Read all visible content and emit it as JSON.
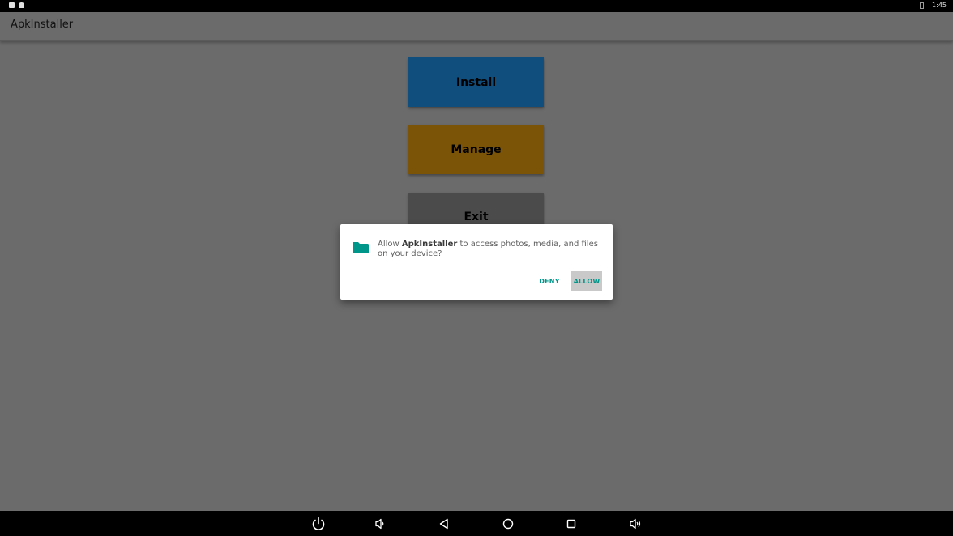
{
  "status_bar": {
    "time": "1:45",
    "left_icons": [
      "notification-icon",
      "android-icon"
    ],
    "right_icons": [
      "battery-icon"
    ]
  },
  "app_bar": {
    "title": "ApkInstaller"
  },
  "main": {
    "install_label": "Install",
    "manage_label": "Manage",
    "exit_label": "Exit"
  },
  "dialog": {
    "text_prefix": "Allow ",
    "app_name": "ApkInstaller",
    "text_suffix": " to access photos, media, and files on your device?",
    "deny_label": "DENY",
    "allow_label": "ALLOW",
    "icon": "folder-icon"
  },
  "nav_bar": {
    "icons": [
      "power-icon",
      "volume-down-icon",
      "back-icon",
      "home-icon",
      "recents-icon",
      "volume-up-icon"
    ]
  },
  "colors": {
    "install_button": "#104e7d",
    "manage_button": "#7c5408",
    "exit_button": "#4b4b4b",
    "accent_teal": "#00968a",
    "scrim": "#6b6b6b"
  }
}
